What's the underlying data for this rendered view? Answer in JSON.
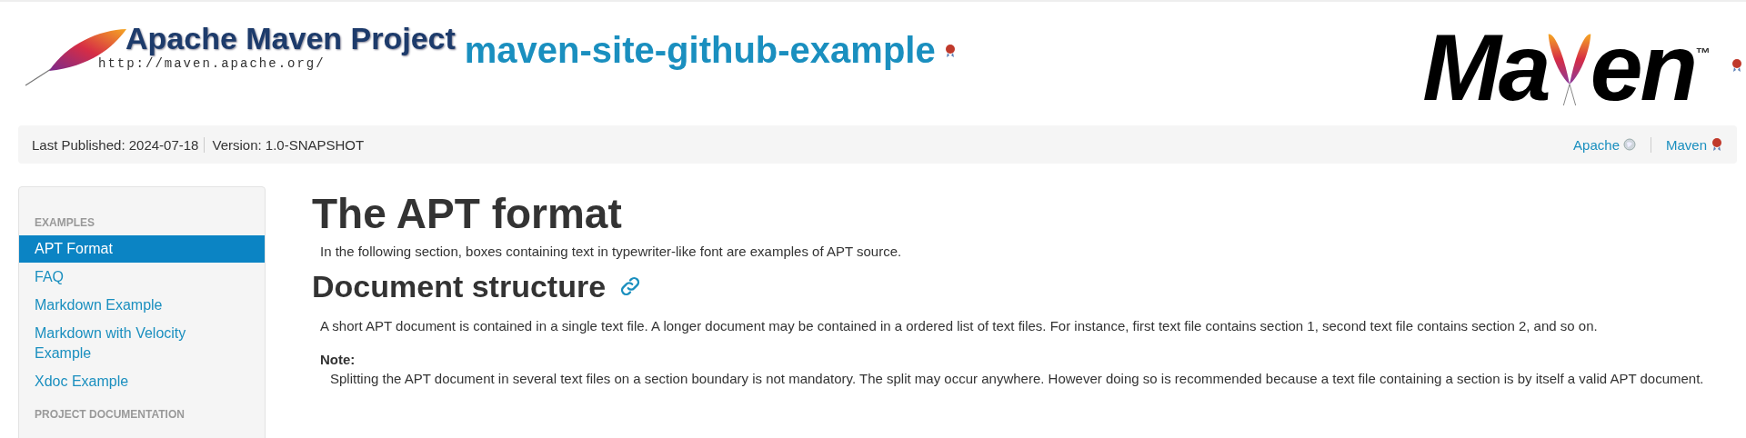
{
  "header": {
    "project_logo": {
      "name": "Apache Maven Project",
      "url": "http://maven.apache.org/"
    },
    "site_title": "maven-site-github-example",
    "maven_logo": {
      "before": "Ma",
      "after": "en",
      "mark": "™"
    }
  },
  "breadcrumbs": {
    "left": [
      "Last Published: 2024-07-18",
      "Version: 1.0-SNAPSHOT"
    ],
    "right": [
      {
        "label": "Apache",
        "kind": "globe"
      },
      {
        "label": "Maven",
        "kind": "ribbon"
      }
    ]
  },
  "sidebar": {
    "sections": [
      {
        "heading": "EXAMPLES",
        "items": [
          {
            "label": "APT Format",
            "selected": true
          },
          {
            "label": "FAQ",
            "selected": false
          },
          {
            "label": "Markdown Example",
            "selected": false
          },
          {
            "label": "Markdown with Velocity Example",
            "selected": false
          },
          {
            "label": "Xdoc Example",
            "selected": false
          }
        ]
      },
      {
        "heading": "PROJECT DOCUMENTATION"
      }
    ]
  },
  "content": {
    "title": "The APT format",
    "intro": "In the following section, boxes containing text in typewriter-like font are examples of APT source.",
    "section_title": "Document structure",
    "paragraph": "A short APT document is contained in a single text file. A longer document may be contained in a ordered list of text files. For instance, first text file contains section 1, second text file contains section 2, and so on.",
    "note": {
      "term": "Note:",
      "text": "Splitting the APT document in several text files on a section boundary is not mandatory. The split may occur anywhere. However doing so is recommended because a text file containing a section is by itself a valid APT document."
    }
  }
}
